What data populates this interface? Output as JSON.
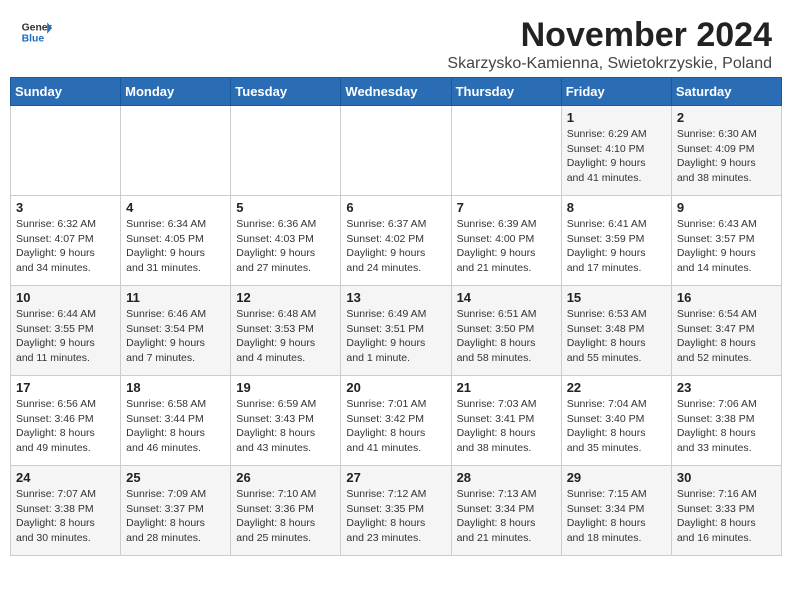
{
  "header": {
    "logo_general": "General",
    "logo_blue": "Blue",
    "title": "November 2024",
    "subtitle": "Skarzysko-Kamienna, Swietokrzyskie, Poland"
  },
  "calendar": {
    "days_of_week": [
      "Sunday",
      "Monday",
      "Tuesday",
      "Wednesday",
      "Thursday",
      "Friday",
      "Saturday"
    ],
    "weeks": [
      [
        {
          "day": "",
          "info": ""
        },
        {
          "day": "",
          "info": ""
        },
        {
          "day": "",
          "info": ""
        },
        {
          "day": "",
          "info": ""
        },
        {
          "day": "",
          "info": ""
        },
        {
          "day": "1",
          "info": "Sunrise: 6:29 AM\nSunset: 4:10 PM\nDaylight: 9 hours\nand 41 minutes."
        },
        {
          "day": "2",
          "info": "Sunrise: 6:30 AM\nSunset: 4:09 PM\nDaylight: 9 hours\nand 38 minutes."
        }
      ],
      [
        {
          "day": "3",
          "info": "Sunrise: 6:32 AM\nSunset: 4:07 PM\nDaylight: 9 hours\nand 34 minutes."
        },
        {
          "day": "4",
          "info": "Sunrise: 6:34 AM\nSunset: 4:05 PM\nDaylight: 9 hours\nand 31 minutes."
        },
        {
          "day": "5",
          "info": "Sunrise: 6:36 AM\nSunset: 4:03 PM\nDaylight: 9 hours\nand 27 minutes."
        },
        {
          "day": "6",
          "info": "Sunrise: 6:37 AM\nSunset: 4:02 PM\nDaylight: 9 hours\nand 24 minutes."
        },
        {
          "day": "7",
          "info": "Sunrise: 6:39 AM\nSunset: 4:00 PM\nDaylight: 9 hours\nand 21 minutes."
        },
        {
          "day": "8",
          "info": "Sunrise: 6:41 AM\nSunset: 3:59 PM\nDaylight: 9 hours\nand 17 minutes."
        },
        {
          "day": "9",
          "info": "Sunrise: 6:43 AM\nSunset: 3:57 PM\nDaylight: 9 hours\nand 14 minutes."
        }
      ],
      [
        {
          "day": "10",
          "info": "Sunrise: 6:44 AM\nSunset: 3:55 PM\nDaylight: 9 hours\nand 11 minutes."
        },
        {
          "day": "11",
          "info": "Sunrise: 6:46 AM\nSunset: 3:54 PM\nDaylight: 9 hours\nand 7 minutes."
        },
        {
          "day": "12",
          "info": "Sunrise: 6:48 AM\nSunset: 3:53 PM\nDaylight: 9 hours\nand 4 minutes."
        },
        {
          "day": "13",
          "info": "Sunrise: 6:49 AM\nSunset: 3:51 PM\nDaylight: 9 hours\nand 1 minute."
        },
        {
          "day": "14",
          "info": "Sunrise: 6:51 AM\nSunset: 3:50 PM\nDaylight: 8 hours\nand 58 minutes."
        },
        {
          "day": "15",
          "info": "Sunrise: 6:53 AM\nSunset: 3:48 PM\nDaylight: 8 hours\nand 55 minutes."
        },
        {
          "day": "16",
          "info": "Sunrise: 6:54 AM\nSunset: 3:47 PM\nDaylight: 8 hours\nand 52 minutes."
        }
      ],
      [
        {
          "day": "17",
          "info": "Sunrise: 6:56 AM\nSunset: 3:46 PM\nDaylight: 8 hours\nand 49 minutes."
        },
        {
          "day": "18",
          "info": "Sunrise: 6:58 AM\nSunset: 3:44 PM\nDaylight: 8 hours\nand 46 minutes."
        },
        {
          "day": "19",
          "info": "Sunrise: 6:59 AM\nSunset: 3:43 PM\nDaylight: 8 hours\nand 43 minutes."
        },
        {
          "day": "20",
          "info": "Sunrise: 7:01 AM\nSunset: 3:42 PM\nDaylight: 8 hours\nand 41 minutes."
        },
        {
          "day": "21",
          "info": "Sunrise: 7:03 AM\nSunset: 3:41 PM\nDaylight: 8 hours\nand 38 minutes."
        },
        {
          "day": "22",
          "info": "Sunrise: 7:04 AM\nSunset: 3:40 PM\nDaylight: 8 hours\nand 35 minutes."
        },
        {
          "day": "23",
          "info": "Sunrise: 7:06 AM\nSunset: 3:38 PM\nDaylight: 8 hours\nand 33 minutes."
        }
      ],
      [
        {
          "day": "24",
          "info": "Sunrise: 7:07 AM\nSunset: 3:38 PM\nDaylight: 8 hours\nand 30 minutes."
        },
        {
          "day": "25",
          "info": "Sunrise: 7:09 AM\nSunset: 3:37 PM\nDaylight: 8 hours\nand 28 minutes."
        },
        {
          "day": "26",
          "info": "Sunrise: 7:10 AM\nSunset: 3:36 PM\nDaylight: 8 hours\nand 25 minutes."
        },
        {
          "day": "27",
          "info": "Sunrise: 7:12 AM\nSunset: 3:35 PM\nDaylight: 8 hours\nand 23 minutes."
        },
        {
          "day": "28",
          "info": "Sunrise: 7:13 AM\nSunset: 3:34 PM\nDaylight: 8 hours\nand 21 minutes."
        },
        {
          "day": "29",
          "info": "Sunrise: 7:15 AM\nSunset: 3:34 PM\nDaylight: 8 hours\nand 18 minutes."
        },
        {
          "day": "30",
          "info": "Sunrise: 7:16 AM\nSunset: 3:33 PM\nDaylight: 8 hours\nand 16 minutes."
        }
      ]
    ]
  }
}
